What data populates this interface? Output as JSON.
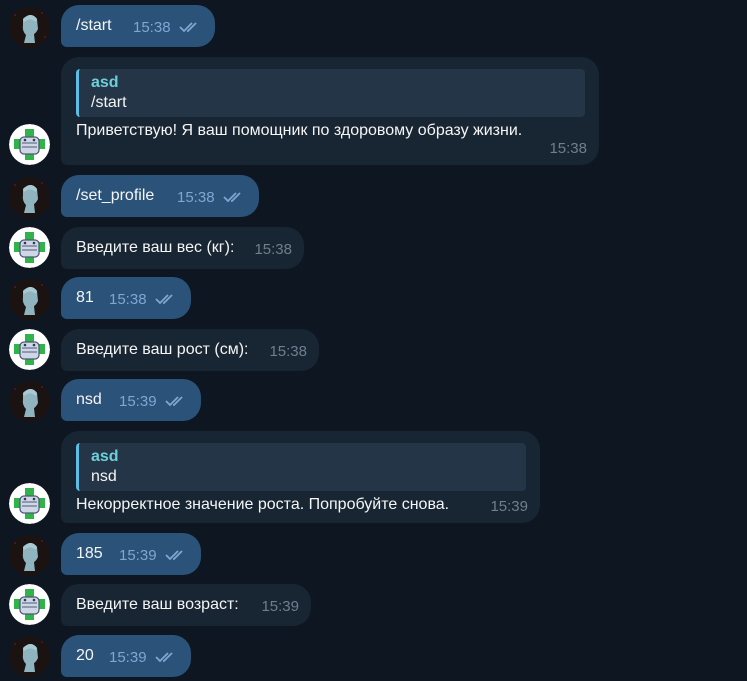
{
  "messages": [
    {
      "side": "out",
      "text": "/start",
      "time": "15:38",
      "status": "read"
    },
    {
      "side": "in",
      "reply": {
        "name": "asd",
        "text": "/start"
      },
      "text": "Приветствую! Я ваш помощник по здоровому образу жизни.",
      "time": "15:38"
    },
    {
      "side": "out",
      "text": "/set_profile",
      "time": "15:38",
      "status": "read"
    },
    {
      "side": "in",
      "text": "Введите ваш вес (кг):",
      "time": "15:38"
    },
    {
      "side": "out",
      "text": "81",
      "time": "15:38",
      "status": "read"
    },
    {
      "side": "in",
      "text": "Введите ваш рост (см):",
      "time": "15:38"
    },
    {
      "side": "out",
      "text": "nsd",
      "time": "15:39",
      "status": "read"
    },
    {
      "side": "in",
      "reply": {
        "name": "asd",
        "text": "nsd"
      },
      "text": "Некорректное значение роста. Попробуйте снова.",
      "time": "15:39"
    },
    {
      "side": "out",
      "text": "185",
      "time": "15:39",
      "status": "read"
    },
    {
      "side": "in",
      "text": "Введите ваш возраст:",
      "time": "15:39"
    },
    {
      "side": "out",
      "text": "20",
      "time": "15:39",
      "status": "read"
    }
  ],
  "colors": {
    "background": "#0e1621",
    "outgoing_bubble": "#2b5278",
    "incoming_bubble": "#182533",
    "reply_accent": "#5ebce5",
    "reply_name": "#6dd0d8",
    "read_ticks": "#7da8d3"
  },
  "icons": {
    "user_avatar": "statue-head-avatar",
    "bot_avatar": "medical-mask-avatar",
    "read_status": "double-check-icon"
  }
}
